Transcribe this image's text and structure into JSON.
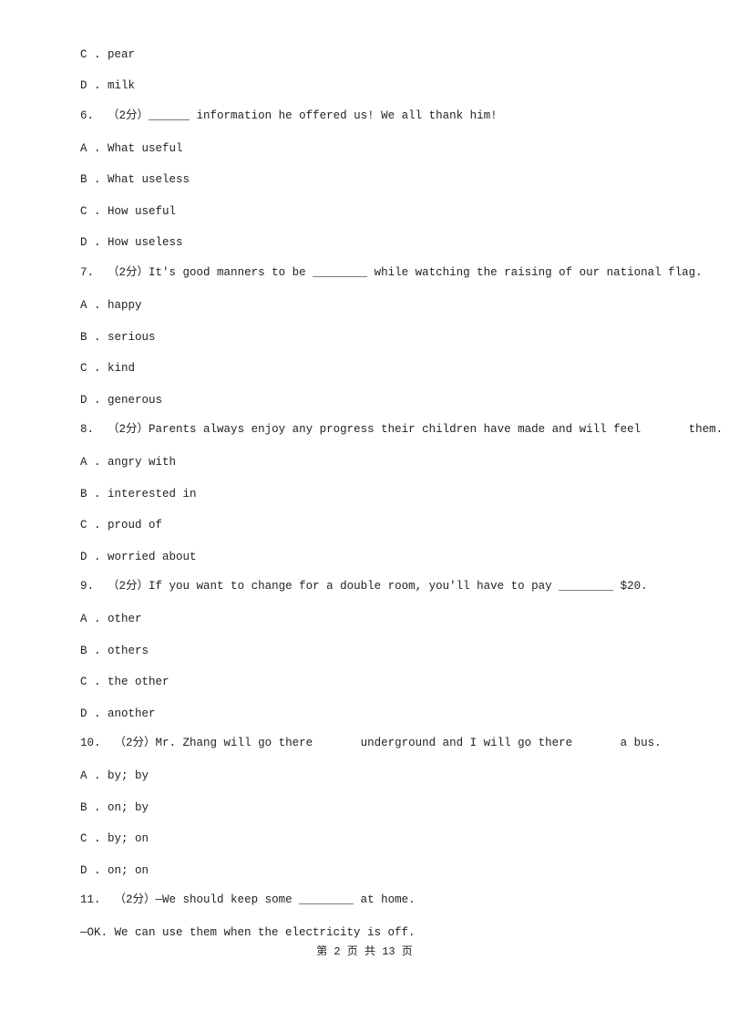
{
  "prev_question_options": [
    {
      "letter": "C",
      "text": "pear"
    },
    {
      "letter": "D",
      "text": "milk"
    }
  ],
  "questions": [
    {
      "number": "6.",
      "score": "（2分）",
      "stem": "______ information he offered us! We all thank him!",
      "options": [
        {
          "letter": "A",
          "text": "What useful"
        },
        {
          "letter": "B",
          "text": "What useless"
        },
        {
          "letter": "C",
          "text": "How useful"
        },
        {
          "letter": "D",
          "text": "How useless"
        }
      ]
    },
    {
      "number": "7.",
      "score": "（2分）",
      "stem": "It's good manners to be ________ while watching the raising of our national flag.",
      "options": [
        {
          "letter": "A",
          "text": "happy"
        },
        {
          "letter": "B",
          "text": "serious"
        },
        {
          "letter": "C",
          "text": "kind"
        },
        {
          "letter": "D",
          "text": "generous"
        }
      ]
    },
    {
      "number": "8.",
      "score": "（2分）",
      "stem": "Parents always enjoy any progress their children have made and will feel       them.",
      "options": [
        {
          "letter": "A",
          "text": "angry with"
        },
        {
          "letter": "B",
          "text": "interested in"
        },
        {
          "letter": "C",
          "text": "proud of"
        },
        {
          "letter": "D",
          "text": "worried about"
        }
      ]
    },
    {
      "number": "9.",
      "score": "（2分）",
      "stem": "If you want to change for a double room, you'll have to pay ________ $20.",
      "options": [
        {
          "letter": "A",
          "text": "other"
        },
        {
          "letter": "B",
          "text": "others"
        },
        {
          "letter": "C",
          "text": "the other"
        },
        {
          "letter": "D",
          "text": "another"
        }
      ]
    },
    {
      "number": "10.",
      "score": "（2分）",
      "stem": "Mr. Zhang will go there       underground and I will go there       a bus.",
      "options": [
        {
          "letter": "A",
          "text": "by; by"
        },
        {
          "letter": "B",
          "text": "on; by"
        },
        {
          "letter": "C",
          "text": "by; on"
        },
        {
          "letter": "D",
          "text": "on; on"
        }
      ]
    },
    {
      "number": "11.",
      "score": "（2分）",
      "stem": "—We should keep some ________ at home.",
      "continuation": "—OK. We can use them when the electricity is off.",
      "options": []
    }
  ],
  "footer": "第 2 页 共 13 页"
}
